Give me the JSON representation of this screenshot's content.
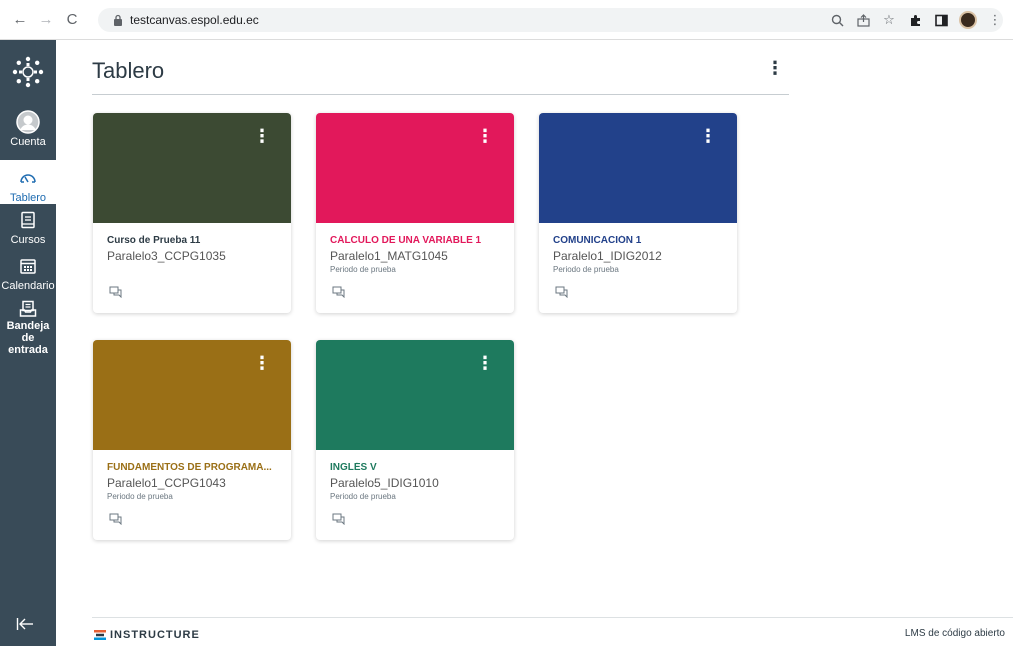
{
  "browser": {
    "url": "testcanvas.espol.edu.ec"
  },
  "global_nav": {
    "items": [
      {
        "label": "Cuenta"
      },
      {
        "label": "Tablero"
      },
      {
        "label": "Cursos"
      },
      {
        "label": "Calendario"
      },
      {
        "label": "Bandeja de entrada"
      }
    ],
    "active_color": "#1f6cb1",
    "background": "#394b58"
  },
  "dashboard": {
    "title": "Tablero"
  },
  "cards": [
    {
      "name": "Curso de Prueba 11",
      "code": "Paralelo3_CCPG1035",
      "term": "",
      "color": "#3c4a33",
      "text_color": "#2d3b45"
    },
    {
      "name": "CÁLCULO DE UNA VARIABLE 1",
      "code": "Paralelo1_MATG1045",
      "term": "Periodo de prueba",
      "color": "#e2185b",
      "text_color": "#e2185b"
    },
    {
      "name": "COMUNICACIÓN 1",
      "code": "Paralelo1_IDIG2012",
      "term": "Periodo de prueba",
      "color": "#22418a",
      "text_color": "#22418a"
    },
    {
      "name": "FUNDAMENTOS DE PROGRAMA...",
      "code": "Paralelo1_CCPG1043",
      "term": "Periodo de prueba",
      "color": "#9a6f16",
      "text_color": "#9a6f16"
    },
    {
      "name": "INGLÉS V",
      "code": "Paralelo5_IDIG1010",
      "term": "Periodo de prueba",
      "color": "#1e7a5e",
      "text_color": "#1e7a5e"
    }
  ],
  "footer": {
    "brand": "INSTRUCTURE",
    "tagline": "LMS de código abierto"
  }
}
